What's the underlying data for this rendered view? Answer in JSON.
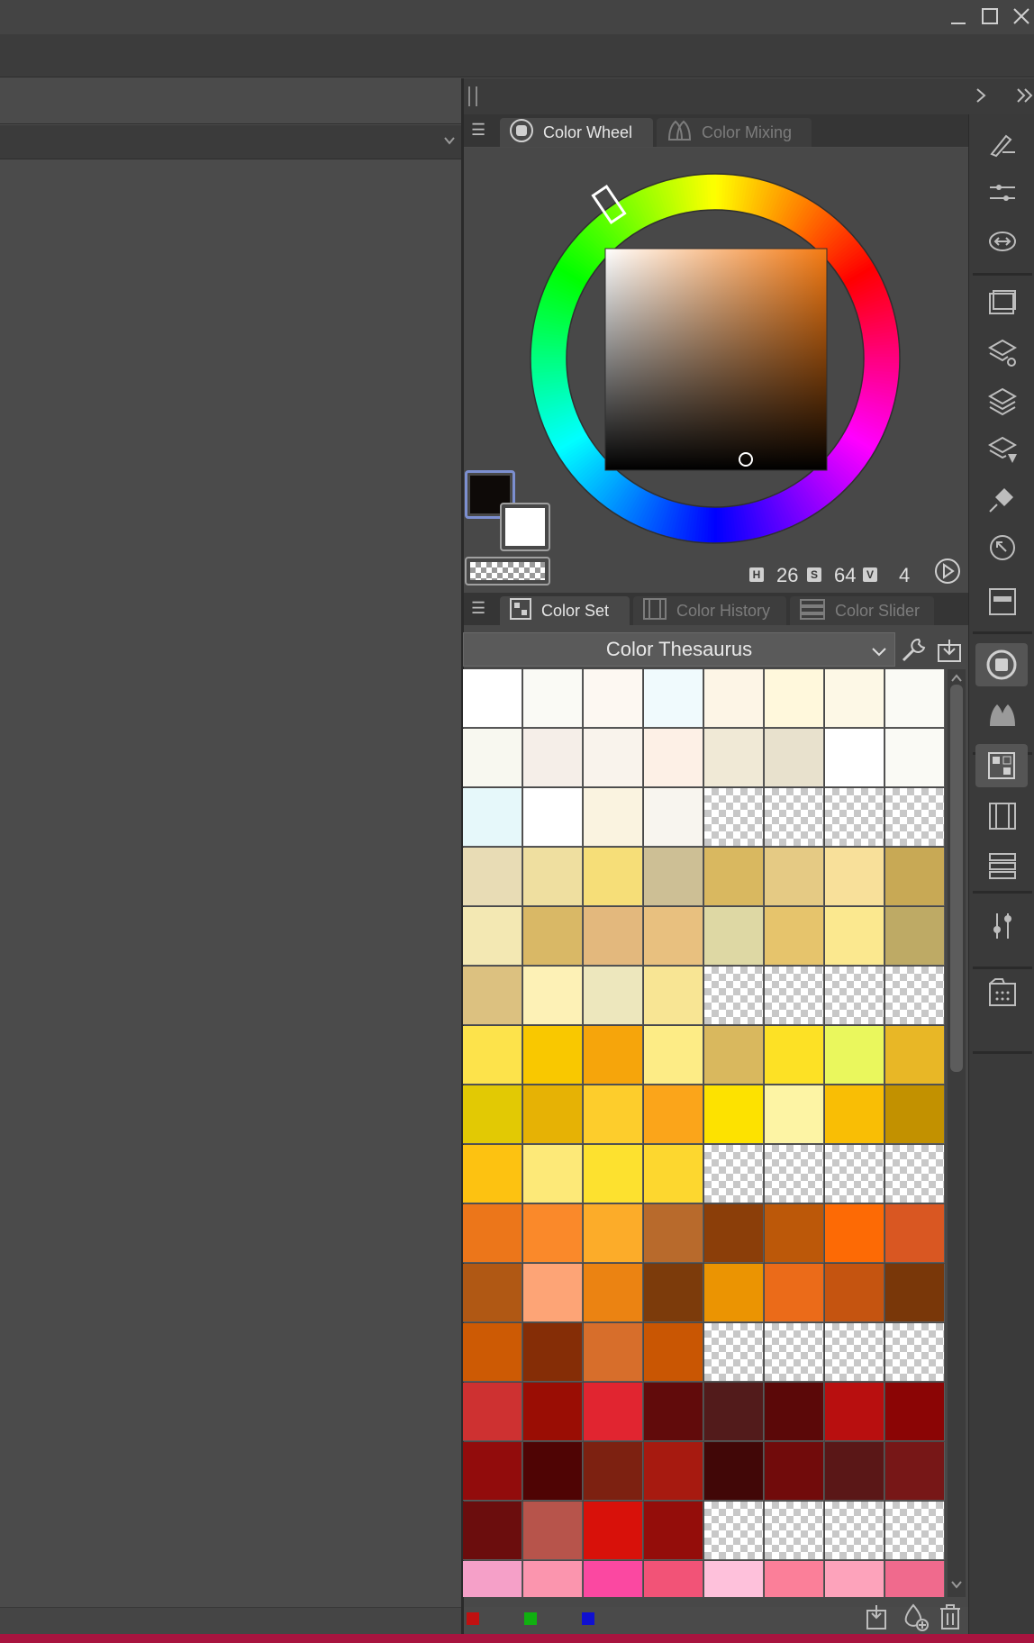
{
  "window": {
    "icons": [
      "minimize-icon",
      "maximize-icon",
      "close-icon"
    ]
  },
  "color_wheel_tabs": [
    {
      "label": "Color Wheel",
      "icon": "color-wheel-icon",
      "active": true
    },
    {
      "label": "Color Mixing",
      "icon": "color-mixing-icon",
      "active": false
    }
  ],
  "color_set_tabs": [
    {
      "label": "Color Set",
      "icon": "color-set-icon",
      "active": true
    },
    {
      "label": "Color History",
      "icon": "color-history-icon",
      "active": false
    },
    {
      "label": "Color Slider",
      "icon": "color-slider-icon",
      "active": false
    }
  ],
  "color_wheel": {
    "hue": "26",
    "saturation": "64",
    "value": "4",
    "h_label": "H",
    "s_label": "S",
    "v_label": "V",
    "main_color": "#0e0a08",
    "sub_color": "#ffffff"
  },
  "color_set": {
    "dropdown_value": "Color Thesaurus",
    "rows": [
      [
        "#ffffff",
        "#fafaf5",
        "#fdf8f2",
        "#f0fafd",
        "#fdf5e6",
        "#fff8dc",
        "#fdf8e6",
        "#fafaf5"
      ],
      [
        "#f8f8f0",
        "#f5eee8",
        "#f9f3ec",
        "#fdf0e6",
        "#f0e9d6",
        "#e8e1cd",
        "#ffffff",
        "#fafaf5"
      ],
      [
        "#e6f8fa",
        "#ffffff",
        "#faf3e0",
        "#f8f5ef",
        null,
        null,
        null,
        null
      ],
      [
        "#e8dcb5",
        "#efdfa0",
        "#f6de78",
        "#cdbf95",
        "#d9b860",
        "#e5ca84",
        "#f8e09a",
        "#c8a955"
      ],
      [
        "#f3e8b3",
        "#d9b866",
        "#e3b87d",
        "#e8c07f",
        "#ded8a4",
        "#e6c46c",
        "#fbe88f",
        "#beaa65"
      ],
      [
        "#dcc180",
        "#fdf1b6",
        "#ede7bd",
        "#f8e594",
        null,
        null,
        null,
        null
      ],
      [
        "#fde34b",
        "#f9c800",
        "#f6a50b",
        "#fdec86",
        "#d9b85e",
        "#fde125",
        "#eaf75d",
        "#e8b726"
      ],
      [
        "#e2c904",
        "#e6b205",
        "#fdcd2c",
        "#fba51a",
        "#fde200",
        "#fdf4a4",
        "#f9be05",
        "#c29100"
      ],
      [
        "#fdc211",
        "#fde978",
        "#fde12f",
        "#fdd72f",
        null,
        null,
        null,
        null
      ],
      [
        "#ec761a",
        "#fa892a",
        "#fcac29",
        "#b86a2c",
        "#8b3e09",
        "#bc5809",
        "#fd6a05",
        "#d95722"
      ],
      [
        "#b05814",
        "#fda476",
        "#eb8312",
        "#7c3b0b",
        "#eb9402",
        "#eb6b19",
        "#c55410",
        "#793709"
      ],
      [
        "#cd5a04",
        "#852d06",
        "#d76e2b",
        "#c95603",
        null,
        null,
        null,
        null
      ],
      [
        "#ce3131",
        "#9a0d04",
        "#e12530",
        "#610b0b",
        "#521b1b",
        "#5b0808",
        "#b80f0f",
        "#8b0505"
      ],
      [
        "#920c0c",
        "#4f0404",
        "#7d2111",
        "#a71a10",
        "#410707",
        "#710b0b",
        "#5a1717",
        "#771717"
      ],
      [
        "#6b0d0d",
        "#b7544b",
        "#d8110a",
        "#940d0a",
        null,
        null,
        null,
        null
      ],
      [
        "#f5a0c8",
        "#fb95ae",
        "#fb48a1",
        "#f25377",
        "#fec1db",
        "#fb7f99",
        "#fda3bb",
        "#f06a8d"
      ]
    ],
    "footer_colors": [
      "#c01010",
      "#10b010",
      "#1010d0"
    ]
  },
  "toolbar": {
    "icons": [
      "tool-property-icon",
      "sub-tool-detail-icon",
      "navigator-icon",
      "canvas-icon",
      "layer-property-icon",
      "layer-icon",
      "layer-search-icon",
      "fill-icon",
      "auto-action-icon",
      "timeline-icon",
      "color-wheel-icon",
      "color-mixing-icon",
      "color-set-icon",
      "color-history-icon",
      "color-slider-icon",
      "adjust-icon",
      "material-icon"
    ]
  }
}
